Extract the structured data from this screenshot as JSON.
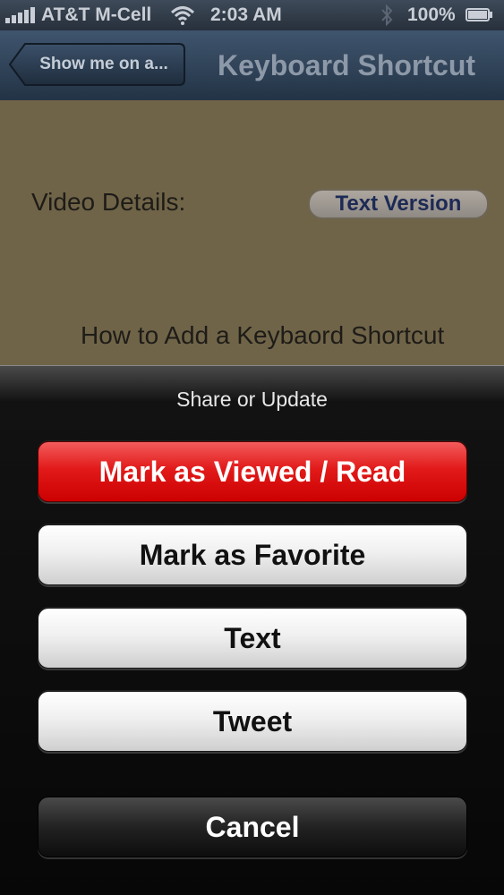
{
  "status_bar": {
    "carrier": "AT&T M-Cell",
    "time": "2:03 AM",
    "battery": "100%",
    "icons": [
      "signal-icon",
      "wifi-icon",
      "bluetooth-icon",
      "battery-icon"
    ]
  },
  "nav": {
    "back_label": "Show me on a...",
    "title": "Keyboard Shortcut"
  },
  "content": {
    "video_details_label": "Video Details:",
    "text_version_button": "Text Version",
    "video_title": "How to Add a Keybaord Shortcut"
  },
  "action_sheet": {
    "title": "Share or Update",
    "buttons": {
      "mark_viewed": "Mark as Viewed / Read",
      "mark_favorite": "Mark as Favorite",
      "text": "Text",
      "tweet": "Tweet",
      "cancel": "Cancel"
    }
  },
  "colors": {
    "destructive": "#e21a1a",
    "content_background": "#706448",
    "nav_bar": "#2d3e52"
  }
}
